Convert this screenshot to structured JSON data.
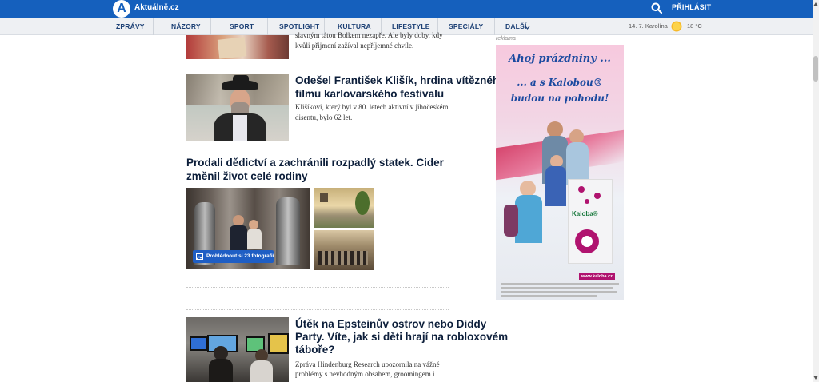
{
  "header": {
    "logo_letter": "A",
    "site_name": "Aktuálně.cz",
    "login_label": "PŘIHLÁSIT",
    "date": "14. 7. Karolína",
    "temperature": "18 °C"
  },
  "nav": {
    "items": [
      "ZPRÁVY",
      "NÁZORY",
      "SPORT",
      "SPOTLIGHT",
      "KULTURA",
      "LIFESTYLE",
      "SPECIÁLY",
      "DALŠÍ"
    ]
  },
  "articles": {
    "top_fragment": {
      "perex_line1": "slavným tátou Bolkem nezapře. Ale byly doby, kdy",
      "perex_line2": "kvůli přijmení zažíval nepříjemné chvíle."
    },
    "klisik": {
      "title_line1": "Odešel František Klišík, hrdina vítězného",
      "title_line2": "filmu karlovarského festivalu",
      "perex_line1": "Klišíkovi, který byl v 80. letech aktivní v jihočeském",
      "perex_line2": "disentu, bylo 62 let."
    },
    "cider": {
      "title_line1": "Prodali dědictví a zachránili rozpadlý statek. Cider",
      "title_line2": "změnil život celé rodiny",
      "gallery_label": "Prohlédnout si 23 fotografií"
    },
    "epstein": {
      "title_line1": "Útěk na Epsteinův ostrov nebo Diddy",
      "title_line2": "Party. Víte, jak si děti hrají na robloxovém",
      "title_line3": "táboře?",
      "perex_line1": "Zpráva Hindenburg Research upozornila na vážné",
      "perex_line2": "problémy s nevhodným obsahem, groomingem i"
    }
  },
  "ad": {
    "label": "reklama",
    "line1": "Ahoj prázdniny ...",
    "line2": "... a s Kalobou®",
    "line3": "budou na pohodu!",
    "brand": "Kaloba®",
    "domain": "www.kaloba.cz"
  },
  "colors": {
    "header_blue": "#1560bd",
    "nav_text": "#1b3f74",
    "headline": "#0c1e3a",
    "ad_magenta": "#b0136f"
  }
}
